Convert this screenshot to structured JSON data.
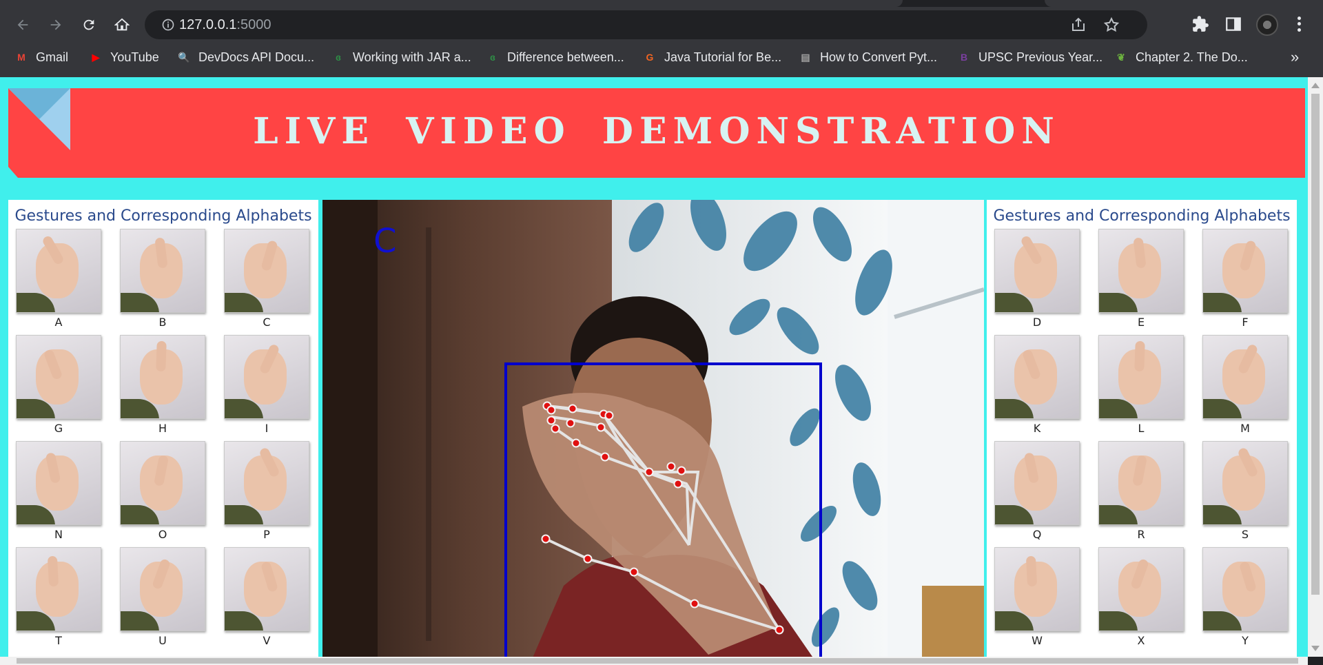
{
  "browser": {
    "url_host": "127.0.0.1",
    "url_port": ":5000",
    "bookmarks": [
      {
        "label": "Gmail",
        "icon": "gmail-icon",
        "color": "#ea4335",
        "glyph": "M"
      },
      {
        "label": "YouTube",
        "icon": "youtube-icon",
        "color": "#ff0000",
        "glyph": "▶"
      },
      {
        "label": "DevDocs API Docu...",
        "icon": "devdocs-icon",
        "color": "#dadce0",
        "glyph": "🔍"
      },
      {
        "label": "Working with JAR a...",
        "icon": "geeksforgeeks-icon",
        "color": "#2f8d46",
        "glyph": "ɞ"
      },
      {
        "label": "Difference between...",
        "icon": "geeksforgeeks-icon",
        "color": "#2f8d46",
        "glyph": "ɞ"
      },
      {
        "label": "Java Tutorial for Be...",
        "icon": "guru99-icon",
        "color": "#f26522",
        "glyph": "G"
      },
      {
        "label": "How to Convert Pyt...",
        "icon": "appdividend-icon",
        "color": "#9e9e9e",
        "glyph": "▤"
      },
      {
        "label": "UPSC Previous Year...",
        "icon": "bookmark-b-icon",
        "color": "#7b3fa0",
        "glyph": "B"
      },
      {
        "label": "Chapter 2. The Do...",
        "icon": "spring-icon",
        "color": "#6db33f",
        "glyph": "❦"
      }
    ],
    "more_label": "»"
  },
  "page": {
    "title": "LIVE VIDEO DEMONSTRATION",
    "background": "#40efec",
    "banner_color": "#ff4444",
    "left_panel": {
      "heading": "Gestures and Corresponding Alphabets",
      "letters": [
        "A",
        "B",
        "C",
        "G",
        "H",
        "I",
        "N",
        "O",
        "P",
        "T",
        "U",
        "V"
      ]
    },
    "right_panel": {
      "heading": "Gestures and Corresponding Alphabets",
      "letters": [
        "D",
        "E",
        "F",
        "K",
        "L",
        "M",
        "Q",
        "R",
        "S",
        "W",
        "X",
        "Y"
      ]
    },
    "video": {
      "predicted_letter": "C",
      "box_color": "#0000cc",
      "landmark_color": "#e01010"
    }
  }
}
